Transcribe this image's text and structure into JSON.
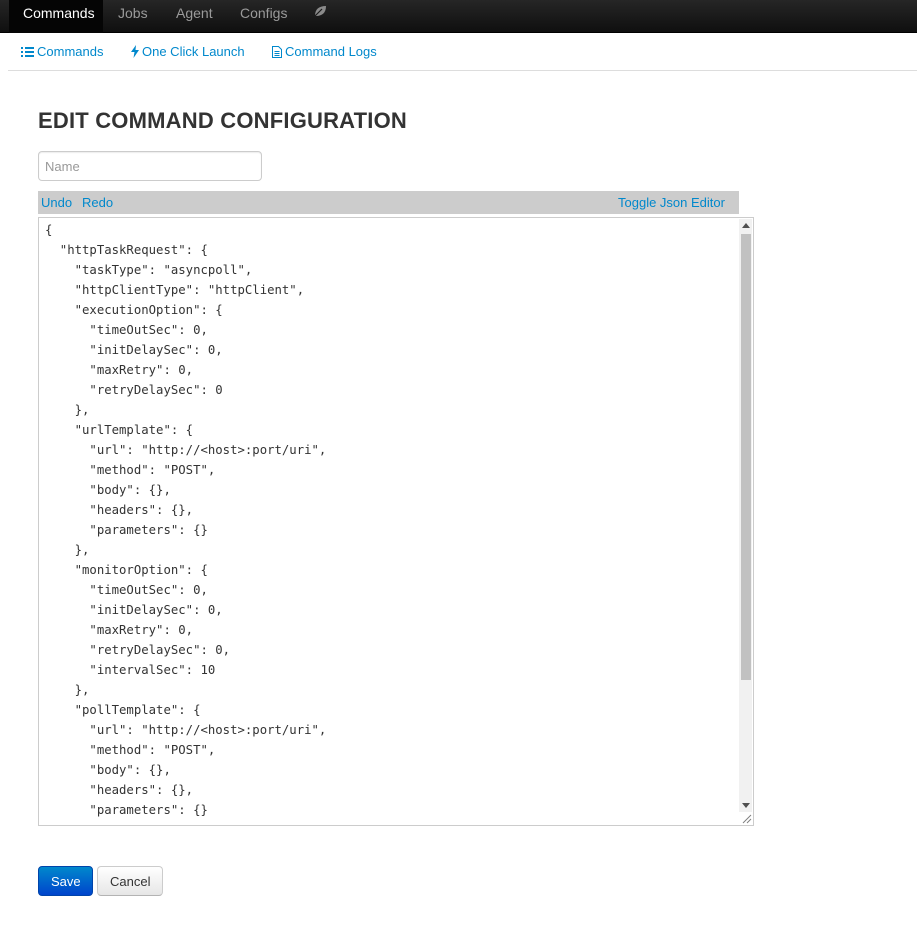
{
  "navbar": {
    "items": [
      {
        "label": "Commands",
        "active": true
      },
      {
        "label": "Jobs",
        "active": false
      },
      {
        "label": "Agent",
        "active": false
      },
      {
        "label": "Configs",
        "active": false
      }
    ],
    "extra_icon": "leaf-icon"
  },
  "subnav": {
    "items": [
      {
        "label": "Commands",
        "icon": "list-icon"
      },
      {
        "label": "One Click Launch",
        "icon": "bolt-icon"
      },
      {
        "label": "Command Logs",
        "icon": "file-icon"
      }
    ]
  },
  "page": {
    "title": "EDIT COMMAND CONFIGURATION",
    "name_placeholder": "Name",
    "name_value": ""
  },
  "editor_toolbar": {
    "undo": "Undo",
    "redo": "Redo",
    "toggle": "Toggle Json Editor"
  },
  "editor": {
    "content": "{\n  \"httpTaskRequest\": {\n    \"taskType\": \"asyncpoll\",\n    \"httpClientType\": \"httpClient\",\n    \"executionOption\": {\n      \"timeOutSec\": 0,\n      \"initDelaySec\": 0,\n      \"maxRetry\": 0,\n      \"retryDelaySec\": 0\n    },\n    \"urlTemplate\": {\n      \"url\": \"http://<host>:port/uri\",\n      \"method\": \"POST\",\n      \"body\": {},\n      \"headers\": {},\n      \"parameters\": {}\n    },\n    \"monitorOption\": {\n      \"timeOutSec\": 0,\n      \"initDelaySec\": 0,\n      \"maxRetry\": 0,\n      \"retryDelaySec\": 0,\n      \"intervalSec\": 10\n    },\n    \"pollTemplate\": {\n      \"url\": \"http://<host>:port/uri\",\n      \"method\": \"POST\",\n      \"body\": {},\n      \"headers\": {},\n      \"parameters\": {}"
  },
  "buttons": {
    "save": "Save",
    "cancel": "Cancel"
  },
  "colors": {
    "link": "#0088cc",
    "navbar_bg": "#1b1b1b",
    "primary_button": "#0066cc",
    "toolbar_bg": "#cccccc"
  }
}
